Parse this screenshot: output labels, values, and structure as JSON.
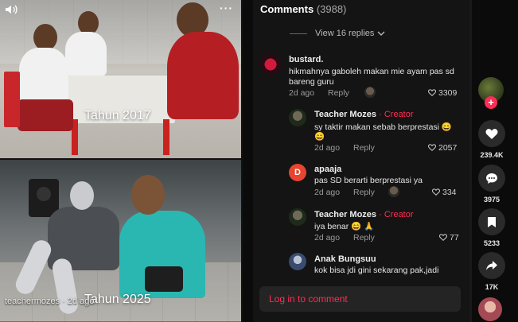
{
  "post": {
    "caption_top": "Tahun 2017",
    "caption_bottom": "Tahun 2025",
    "watermark": "teachermozes · 2d ago",
    "volume_icon": "volume-icon",
    "more_icon": "more-icon",
    "more_symbol": "···"
  },
  "comments": {
    "title": "Comments",
    "count": "(3988)",
    "view_replies": "View 16 replies",
    "items": [
      {
        "user": "bustard.",
        "creator": "",
        "text": "hikmahnya gaboleh makan mie ayam pas sd",
        "text2": "bareng guru",
        "date": "2d ago",
        "reply": "Reply",
        "likes": "3309"
      },
      {
        "user": "Teacher Mozes",
        "creator": " · Creator",
        "text": "sy taktir makan sebab berprestasi 😄",
        "text2": "😄",
        "date": "2d ago",
        "reply": "Reply",
        "likes": "2057"
      },
      {
        "user": "apaaja",
        "creator": "",
        "text": "pas SD berarti berprestasi ya",
        "text2": "",
        "date": "2d ago",
        "reply": "Reply",
        "likes": "334",
        "avatar_letter": "D"
      },
      {
        "user": "Teacher Mozes",
        "creator": " · Creator",
        "text": "iya benar 😄 🙏",
        "text2": "",
        "date": "2d ago",
        "reply": "Reply",
        "likes": "77"
      },
      {
        "user": "Anak Bungsuu",
        "creator": "",
        "text": "kok bisa jdi gini sekarang pak,jadi",
        "text2": "",
        "date": "",
        "reply": "",
        "likes": ""
      }
    ],
    "login": "Log in to comment"
  },
  "rail": {
    "follow_symbol": "+",
    "likes": "239.4K",
    "comments": "3975",
    "saves": "5233",
    "shares": "17K"
  },
  "colors": {
    "accent": "#fe2c55",
    "panel": "#141414",
    "teal_shirt": "#2bb7b1"
  }
}
